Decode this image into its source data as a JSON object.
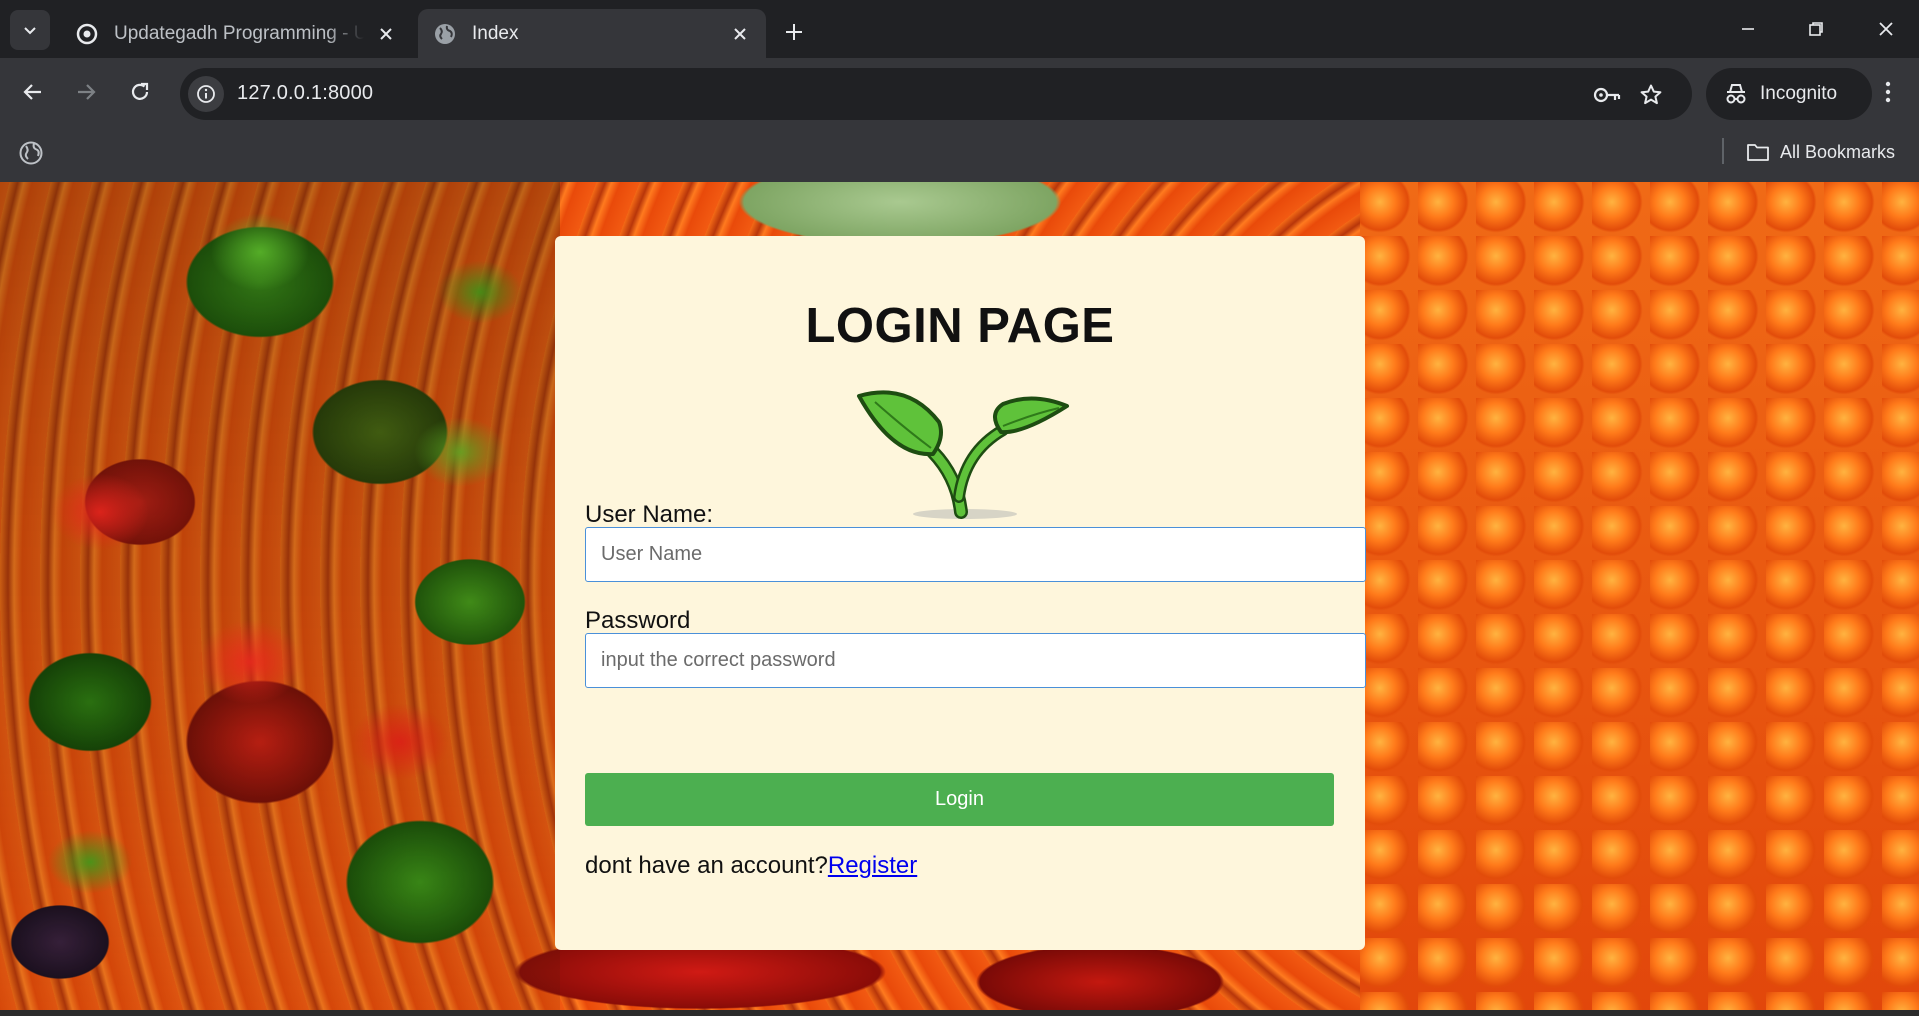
{
  "browser": {
    "tabs": [
      {
        "title": "Updategadh Programming - Up",
        "active": false,
        "favicon": "updategadh-logo-icon"
      },
      {
        "title": "Index",
        "active": true,
        "favicon": "globe-icon"
      }
    ],
    "url": "127.0.0.1:8000",
    "profile_label": "Incognito",
    "bookmarks_label": "All Bookmarks"
  },
  "page": {
    "title": "LOGIN PAGE",
    "username_label": "User Name:",
    "username_placeholder": "User Name",
    "password_label": "Password",
    "password_placeholder": "input the correct password",
    "login_label": "Login",
    "register_prompt": "dont have an account?",
    "register_link": "Register"
  },
  "colors": {
    "card_bg": "#fef6dc",
    "login_button": "#4caf50",
    "link": "#0000ee",
    "input_border": "#4a90d9"
  }
}
